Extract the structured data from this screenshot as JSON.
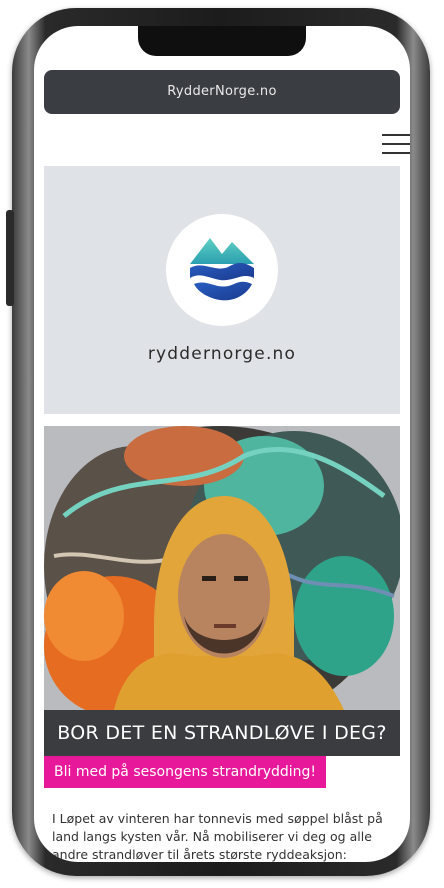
{
  "browser": {
    "url": "RydderNorge.no"
  },
  "site": {
    "logo_text": "ryddernorge.no",
    "headline": "BOR DET EN STRANDLØVE I DEG?",
    "cta_label": "Bli med på sesongens strandrydding!",
    "body": "I Løpet av vinteren har tonnevis med søppel blåst på land langs kysten vår. Nå mobiliserer vi deg og alle andre strandløver til årets største ryddeaksjon:"
  },
  "icons": {
    "menu": "hamburger-menu-icon",
    "logo": "mountain-wave-logo-icon"
  },
  "colors": {
    "url_bar": "#3a3d42",
    "headline_bar": "#3a3c40",
    "cta": "#e8189a",
    "logo_panel": "#dfe2e6"
  }
}
